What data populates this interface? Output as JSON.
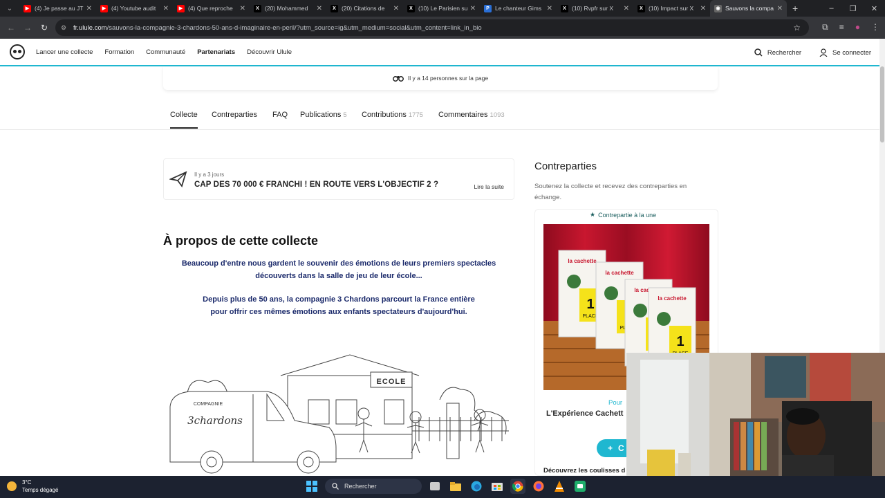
{
  "browser": {
    "tabs": [
      {
        "label": "(4) Je passe au JT",
        "fav_color": "#ff0000",
        "fav": "▶"
      },
      {
        "label": "(4) Youtube audit",
        "fav_color": "#ff0000",
        "fav": "▶"
      },
      {
        "label": "(4) Que reproche",
        "fav_color": "#ff0000",
        "fav": "▶"
      },
      {
        "label": "(20) Mohammed",
        "fav_color": "#000000",
        "fav": "X"
      },
      {
        "label": "(20) Citations de",
        "fav_color": "#000000",
        "fav": "X"
      },
      {
        "label": "(10) Le Parisien su",
        "fav_color": "#000000",
        "fav": "X"
      },
      {
        "label": "Le chanteur Gims",
        "fav_color": "#2a6fd6",
        "fav": "P"
      },
      {
        "label": "(10) Rvpfr sur X",
        "fav_color": "#000000",
        "fav": "X"
      },
      {
        "label": "(10) Impact sur X",
        "fav_color": "#000000",
        "fav": "X"
      },
      {
        "label": "Sauvons la compa",
        "fav_color": "#666666",
        "fav": "◉"
      }
    ],
    "url_host": "fr.ulule.com",
    "url_path": "/sauvons-la-compagnie-3-chardons-50-ans-d-imaginaire-en-peril/?utm_source=ig&utm_medium=social&utm_content=link_in_bio"
  },
  "site_header": {
    "nav": [
      "Lancer une collecte",
      "Formation",
      "Communauté",
      "Partenariats",
      "Découvrir Ulule"
    ],
    "search_label": "Rechercher",
    "login_label": "Se connecter"
  },
  "visitors_text": "Il y a 14 personnes sur la page",
  "page_tabs": [
    {
      "label": "Collecte",
      "count": ""
    },
    {
      "label": "Contreparties",
      "count": ""
    },
    {
      "label": "FAQ",
      "count": ""
    },
    {
      "label": "Publications",
      "count": "5"
    },
    {
      "label": "Contributions",
      "count": "1775"
    },
    {
      "label": "Commentaires",
      "count": "1093"
    }
  ],
  "news": {
    "meta": "Il y a 3 jours",
    "headline": "CAP DES 70 000 € FRANCHI ! EN ROUTE VERS L'OBJECTIF 2 ?",
    "more": "Lire la suite"
  },
  "about": {
    "title": "À propos de cette collecte",
    "p1_line1": "Beaucoup d'entre nous gardent le souvenir des émotions de leurs premiers spectacles",
    "p1_line2": "découverts dans la salle de jeu de leur école...",
    "p2_line1": "Depuis plus de 50 ans, la compagnie 3 Chardons parcourt la France entière",
    "p2_line2": "pour offrir ces mêmes émotions aux enfants spectateurs d'aujourd'hui."
  },
  "illustration": {
    "school_sign": "ECOLE",
    "van_text_1": "COMPAGNIE",
    "van_text_2": "3chardons"
  },
  "rewards": {
    "title": "Contreparties",
    "subtitle": "Soutenez la collecte et recevez des contreparties en échange.",
    "featured_badge": "Contrepartie à la une",
    "ticket_brand": "la cachette",
    "ticket_number": "1",
    "ticket_word": "PLACE",
    "pour": "Pour",
    "reward_name": "L'Expérience Cachett",
    "button_label": "C",
    "discover": "Découvrez les coulisses d"
  },
  "taskbar": {
    "temp": "3°C",
    "weather": "Temps dégagé",
    "search": "Rechercher"
  },
  "colors": {
    "accent": "#1fb7d0",
    "about_text": "#1b2a6b",
    "curtain": "#b5122a",
    "ticket_yellow": "#f5e21a"
  }
}
